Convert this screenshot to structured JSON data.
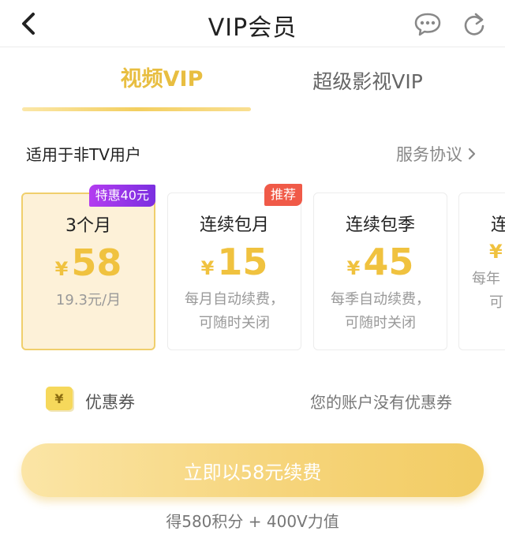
{
  "header": {
    "title": "VIP会员",
    "back_icon": "chevron-left-icon",
    "message_icon": "chat-bubble-icon",
    "refresh_icon": "refresh-icon"
  },
  "tabs": [
    {
      "label": "视频VIP",
      "active": true
    },
    {
      "label": "超级影视VIP",
      "active": false
    }
  ],
  "info": {
    "audience": "适用于非TV用户",
    "agreement": "服务协议",
    "agreement_icon": "chevron-right-icon"
  },
  "plans": [
    {
      "name": "3个月",
      "currency": "¥",
      "price": "58",
      "desc1": "19.3元/月",
      "desc2": "",
      "badge": "特惠40元",
      "selected": true
    },
    {
      "name": "连续包月",
      "currency": "¥",
      "price": "15",
      "desc1": "每月自动续费，",
      "desc2": "可随时关闭",
      "badge": "推荐",
      "selected": false
    },
    {
      "name": "连续包季",
      "currency": "¥",
      "price": "45",
      "desc1": "每季自动续费，",
      "desc2": "可随时关闭",
      "badge": "",
      "selected": false
    },
    {
      "name": "连",
      "currency": "¥",
      "price": "",
      "desc1": "每年",
      "desc2": "可",
      "badge": "",
      "selected": false
    }
  ],
  "coupon": {
    "icon_symbol": "¥",
    "label": "优惠券",
    "status": "您的账户没有优惠券"
  },
  "pay_button": "立即以58元续费",
  "points_text": "得580积分 + 400V力值",
  "colors": {
    "accent": "#f0c23f",
    "badge_purple": "#9a34e8",
    "badge_red": "#f05a48",
    "selected_bg": "#fdf1d8"
  }
}
